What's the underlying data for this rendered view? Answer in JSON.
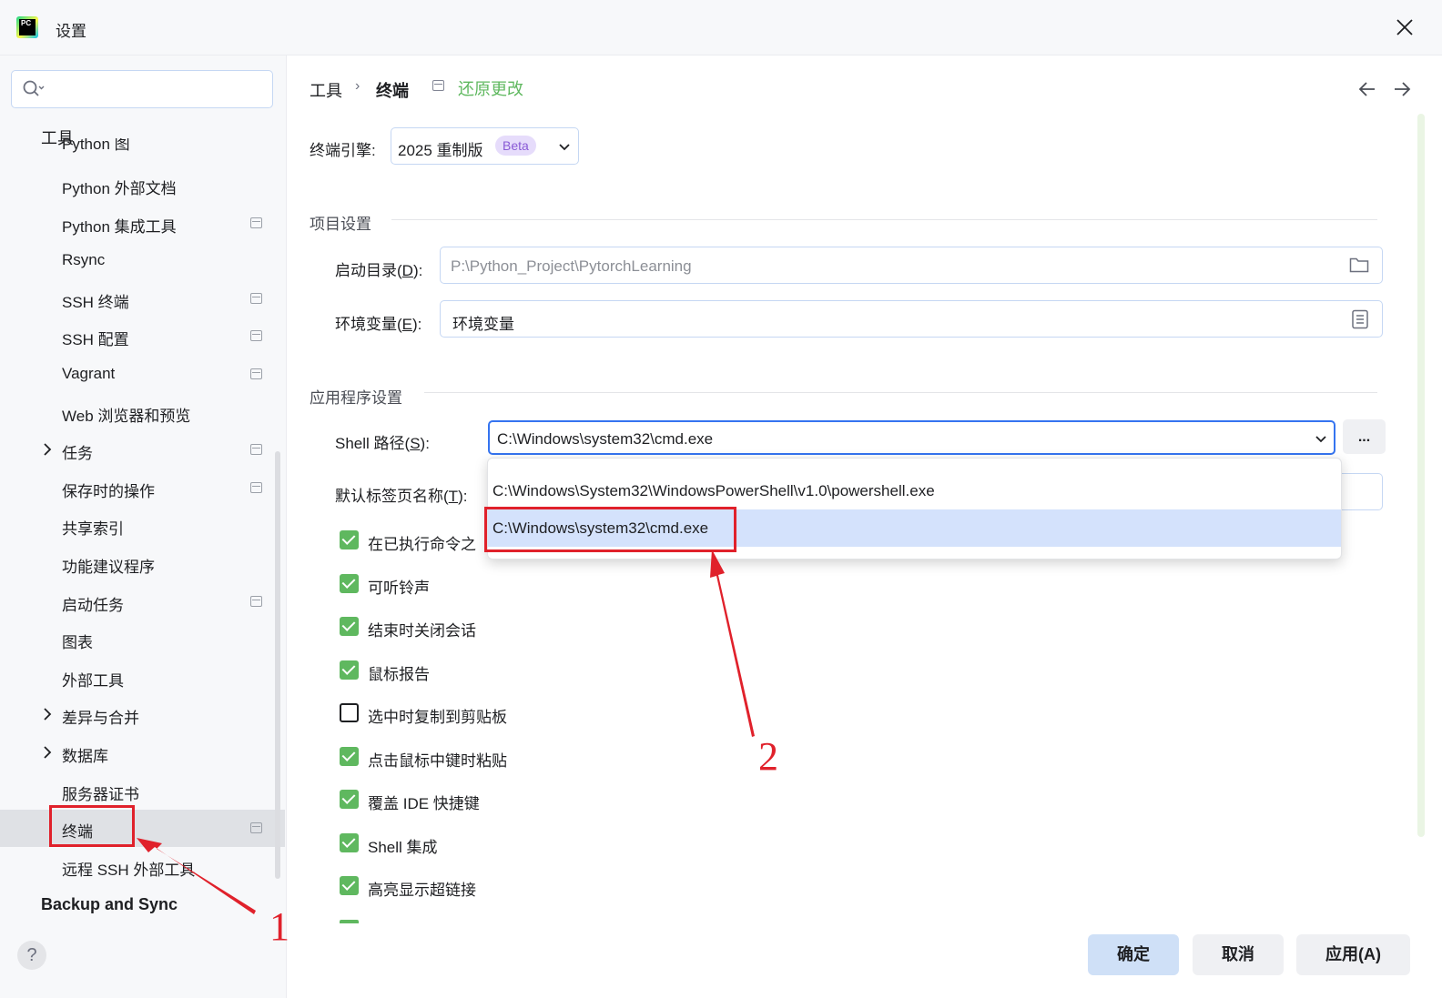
{
  "window": {
    "title": "设置",
    "app_icon_text": "PC"
  },
  "search": {
    "placeholder": ""
  },
  "sidebar": {
    "section_title": "工具",
    "partial_item": "Python 图",
    "items": [
      {
        "label": "Python 外部文档",
        "pinned": false,
        "expandable": false
      },
      {
        "label": "Python 集成工具",
        "pinned": true,
        "expandable": false
      },
      {
        "label": "Rsync",
        "pinned": false,
        "expandable": false
      },
      {
        "label": "SSH 终端",
        "pinned": true,
        "expandable": false
      },
      {
        "label": "SSH 配置",
        "pinned": true,
        "expandable": false
      },
      {
        "label": "Vagrant",
        "pinned": true,
        "expandable": false
      },
      {
        "label": "Web 浏览器和预览",
        "pinned": false,
        "expandable": false
      },
      {
        "label": "任务",
        "pinned": true,
        "expandable": true
      },
      {
        "label": "保存时的操作",
        "pinned": true,
        "expandable": false
      },
      {
        "label": "共享索引",
        "pinned": false,
        "expandable": false
      },
      {
        "label": "功能建议程序",
        "pinned": false,
        "expandable": false
      },
      {
        "label": "启动任务",
        "pinned": true,
        "expandable": false
      },
      {
        "label": "图表",
        "pinned": false,
        "expandable": false
      },
      {
        "label": "外部工具",
        "pinned": false,
        "expandable": false
      },
      {
        "label": "差异与合并",
        "pinned": false,
        "expandable": true
      },
      {
        "label": "数据库",
        "pinned": false,
        "expandable": true
      },
      {
        "label": "服务器证书",
        "pinned": false,
        "expandable": false
      },
      {
        "label": "终端",
        "pinned": true,
        "expandable": false,
        "selected": true
      },
      {
        "label": "远程 SSH 外部工具",
        "pinned": false,
        "expandable": false
      }
    ],
    "bottom_section": "Backup and Sync",
    "help": "?"
  },
  "header": {
    "breadcrumb": [
      "工具",
      "终端"
    ],
    "separator": "›",
    "revert_label": "还原更改"
  },
  "engine": {
    "label": "终端引擎:",
    "value": "2025 重制版",
    "badge": "Beta"
  },
  "project_settings": {
    "title": "项目设置",
    "start_dir": {
      "label_prefix": "启动目录(",
      "mnemonic": "D",
      "label_suffix": "):",
      "value": "P:\\Python_Project\\PytorchLearning"
    },
    "env_vars": {
      "label_prefix": "环境变量(",
      "mnemonic": "E",
      "label_suffix": "):",
      "value": "环境变量"
    }
  },
  "app_settings": {
    "title": "应用程序设置",
    "shell_path": {
      "label_prefix": "Shell 路径(",
      "mnemonic": "S",
      "label_suffix": "):",
      "value": "C:\\Windows\\system32\\cmd.exe",
      "browse": "..."
    },
    "tab_name": {
      "label_prefix": "默认标签页名称(",
      "mnemonic": "T",
      "label_suffix": "):"
    },
    "dropdown_options": [
      "C:\\Windows\\System32\\WindowsPowerShell\\v1.0\\powershell.exe",
      "C:\\Windows\\system32\\cmd.exe"
    ],
    "selected_option_index": 1
  },
  "checkboxes": [
    {
      "label": "在已执行命令之",
      "checked": true
    },
    {
      "label": "可听铃声",
      "checked": true
    },
    {
      "label": "结束时关闭会话",
      "checked": true
    },
    {
      "label": "鼠标报告",
      "checked": true
    },
    {
      "label": "选中时复制到剪贴板",
      "checked": false
    },
    {
      "label": "点击鼠标中键时粘贴",
      "checked": true
    },
    {
      "label": "覆盖 IDE 快捷键",
      "checked": true
    },
    {
      "label": "Shell 集成",
      "checked": true
    },
    {
      "label": "高亮显示超链接",
      "checked": true
    }
  ],
  "footer": {
    "ok": "确定",
    "cancel": "取消",
    "apply": "应用(A)"
  },
  "annotations": {
    "marker_1": "1",
    "marker_2": "2",
    "color": "#e0212b"
  },
  "colors": {
    "accent": "#3574f0",
    "checkbox_on": "#5fb85f",
    "revert_link": "#5fb85f",
    "beta_badge": "#8a5bd6",
    "selection": "#d4e2fc"
  }
}
